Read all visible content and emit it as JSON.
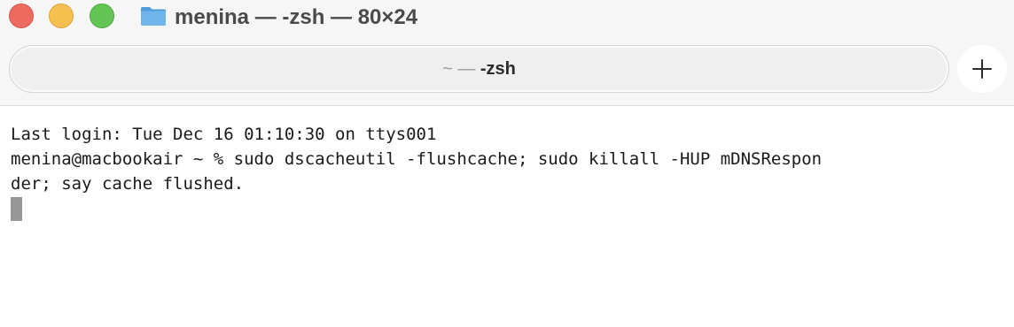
{
  "window": {
    "title": "menina — -zsh — 80×24",
    "controls": [
      "close",
      "minimize",
      "zoom"
    ],
    "folder_icon": "folder-icon"
  },
  "tab": {
    "prefix": "~ — ",
    "name": "-zsh"
  },
  "new_tab_icon": "plus-icon",
  "terminal": {
    "lines": [
      "Last login: Tue Dec 16 01:10:30 on ttys001",
      "menina@macbookair ~ % sudo dscacheutil -flushcache; sudo killall -HUP mDNSRespon",
      "der; say cache flushed."
    ]
  },
  "colors": {
    "close": "#ed6a5e",
    "minimize": "#f5c04f",
    "zoom": "#62c554",
    "folder": "#5aa5e3",
    "cursor": "#969696"
  }
}
